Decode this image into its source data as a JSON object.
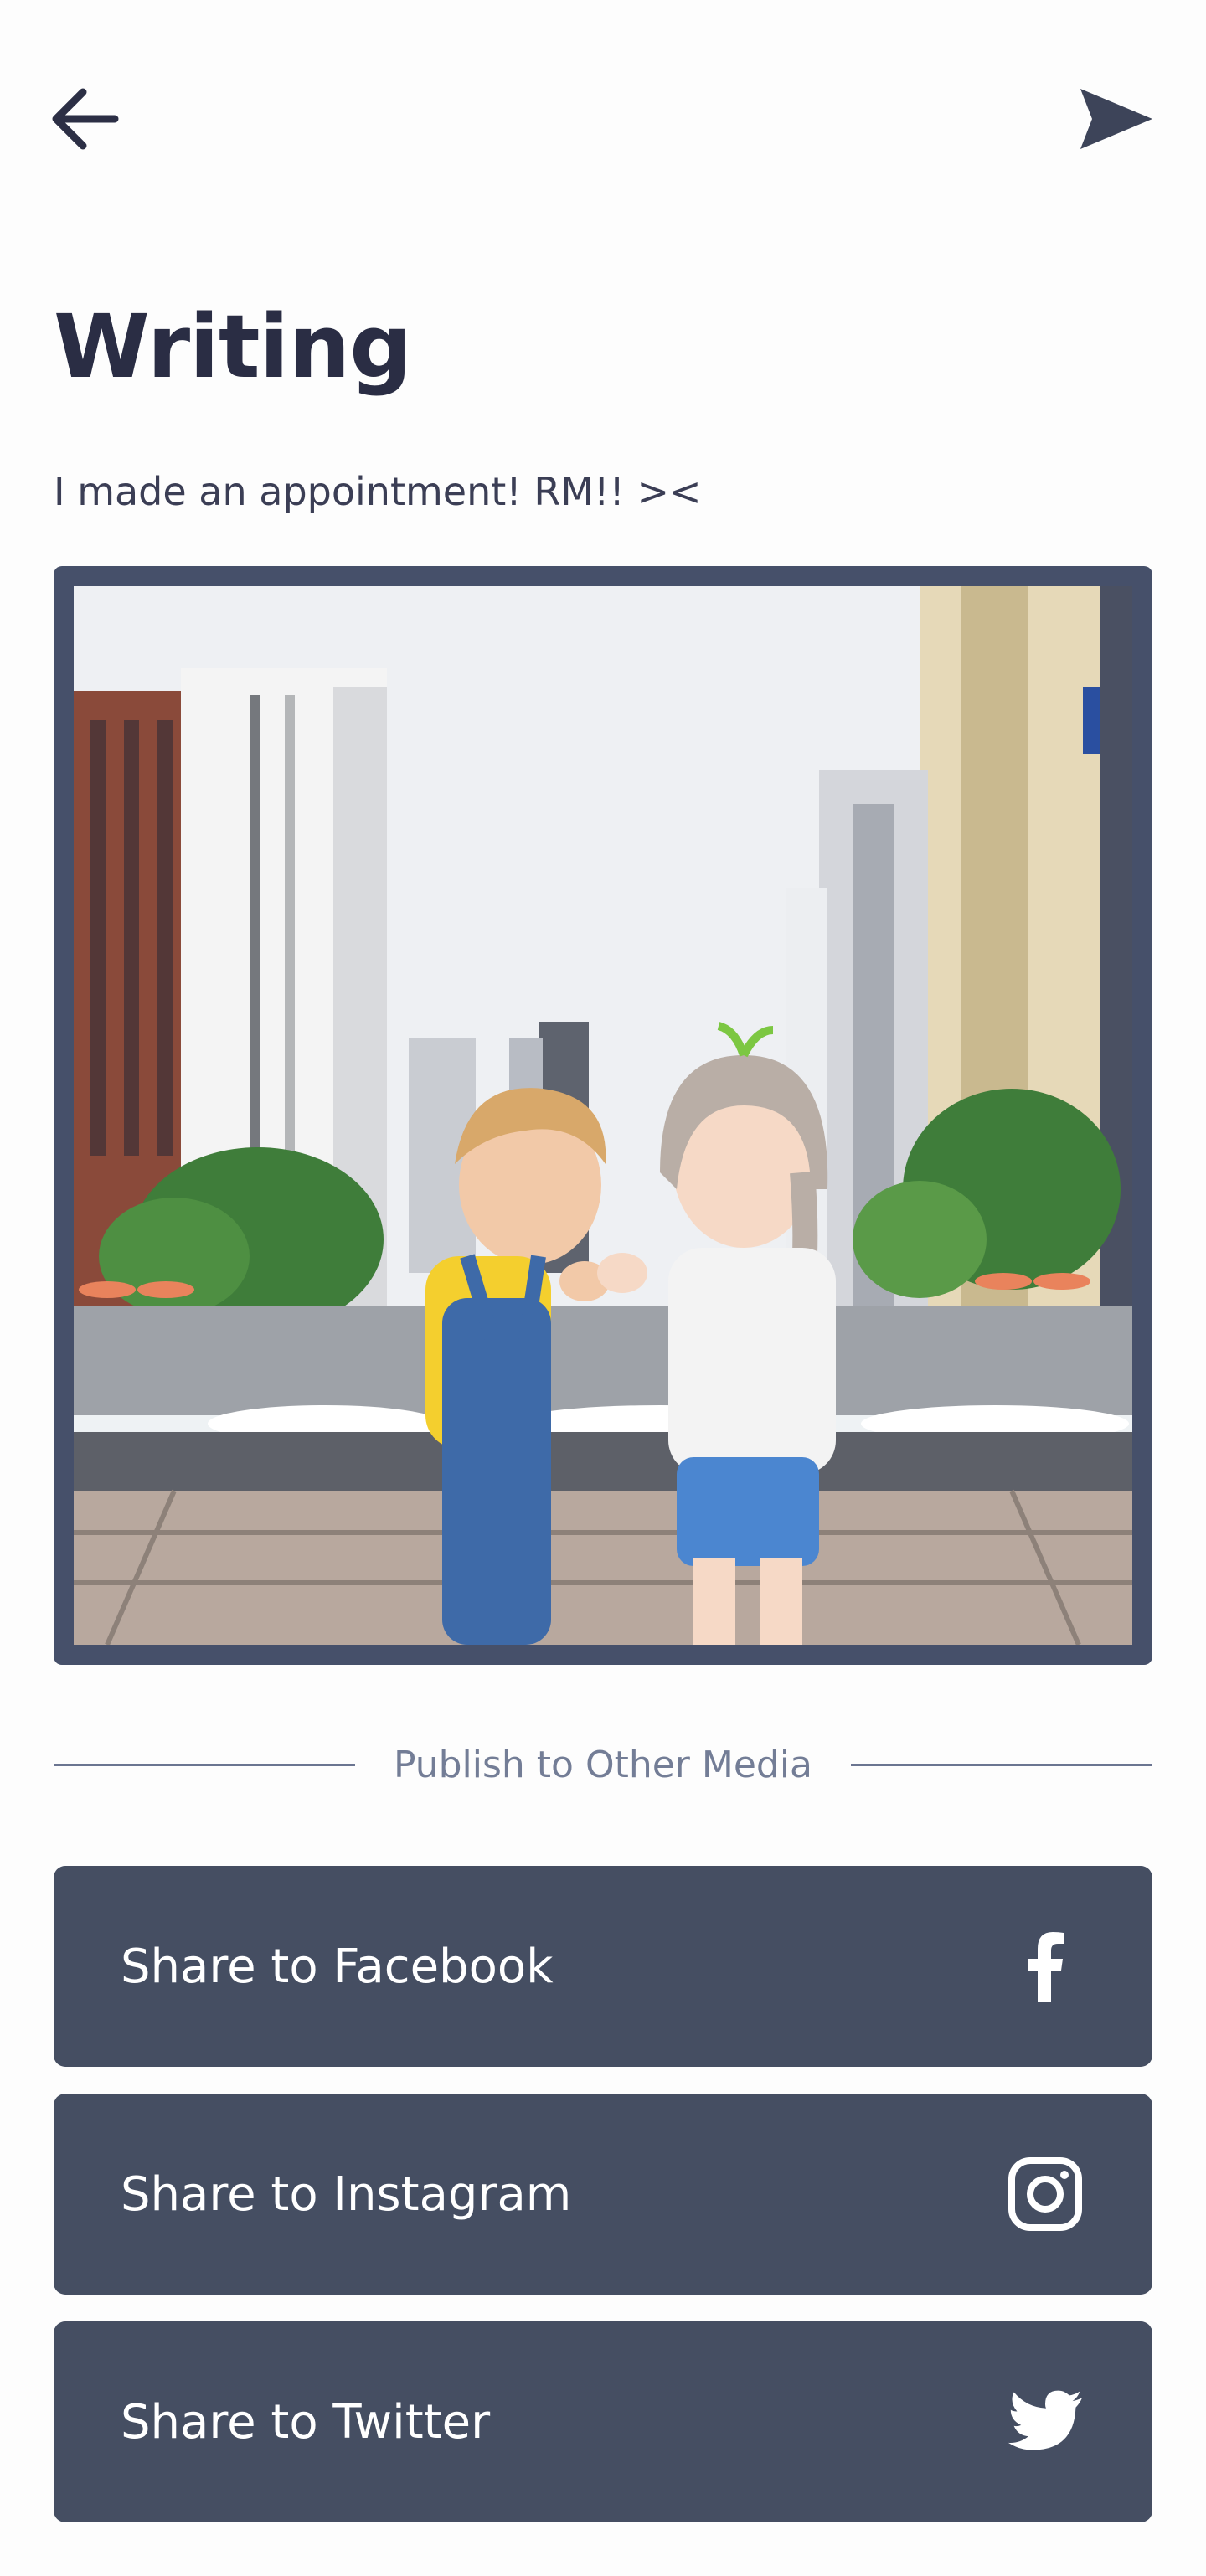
{
  "header": {
    "back_icon": "arrow-left-icon",
    "send_icon": "send-icon"
  },
  "post": {
    "title": "Writing",
    "caption": "I made an appointment! RM!! ><"
  },
  "publish": {
    "divider_label": "Publish to Other Media",
    "buttons": [
      {
        "label": "Share to Facebook",
        "icon": "facebook-icon"
      },
      {
        "label": "Share to Instagram",
        "icon": "instagram-icon"
      },
      {
        "label": "Share to Twitter",
        "icon": "twitter-icon"
      }
    ]
  },
  "colors": {
    "text_dark": "#2a2d44",
    "button_bg": "#454e62",
    "frame_border": "#46506a",
    "divider": "#6b7591"
  }
}
